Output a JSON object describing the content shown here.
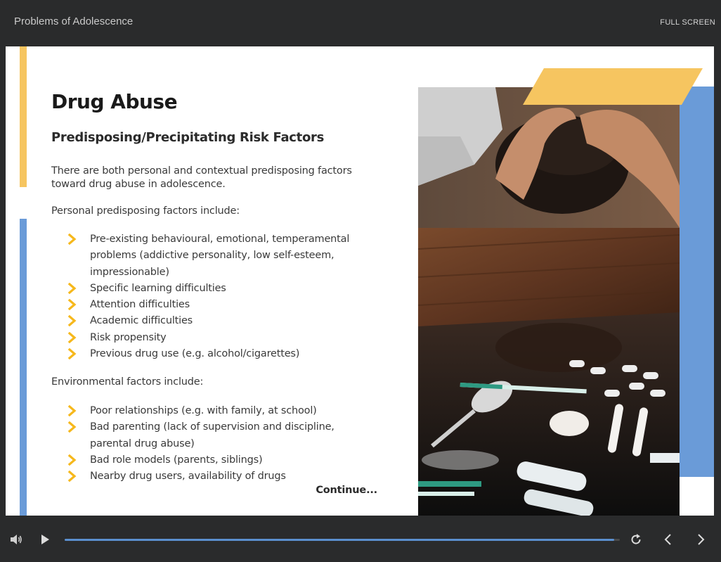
{
  "header": {
    "course_title": "Problems of Adolescence",
    "fullscreen_label": "FULL SCREEN"
  },
  "slide": {
    "title": "Drug Abuse",
    "subtitle": "Predisposing/Precipitating Risk Factors",
    "intro_line1": "There are both personal and contextual predisposing factors",
    "intro_line2": "toward drug abuse in adolescence.",
    "personal_heading": "Personal predisposing factors include:",
    "personal_factors": [
      {
        "line1": "Pre-existing behavioural, emotional, temperamental",
        "line2": "problems (addictive personality, low self-esteem,",
        "line3": "impressionable)"
      },
      {
        "line1": "Specific learning difficulties"
      },
      {
        "line1": "Attention difficulties"
      },
      {
        "line1": "Academic difficulties"
      },
      {
        "line1": "Risk propensity"
      },
      {
        "line1": "Previous drug use (e.g. alcohol/cigarettes)"
      }
    ],
    "environmental_heading": "Environmental factors include:",
    "environmental_factors": [
      {
        "line1": "Poor relationships (e.g. with family, at school)"
      },
      {
        "line1": "Bad parenting (lack of supervision and discipline,",
        "line2": "parental drug abuse)"
      },
      {
        "line1": "Bad role models (parents, siblings)"
      },
      {
        "line1": "Nearby drug users, availability of drugs"
      }
    ],
    "continue_label": "Continue...",
    "image_icon": "photo-distressed-person-with-drugs"
  },
  "player": {
    "progress": 0.99,
    "icons": {
      "volume": "volume-icon",
      "play": "play-icon",
      "replay": "replay-icon",
      "previous": "chevron-left-icon",
      "next": "chevron-right-icon"
    }
  },
  "colors": {
    "accent_yellow": "#f6c560",
    "accent_blue": "#6a9bd8",
    "bullet_chevron": "#f6b81c",
    "chrome_background": "#2a2b2c",
    "progress_fill": "#5b8fcf"
  }
}
